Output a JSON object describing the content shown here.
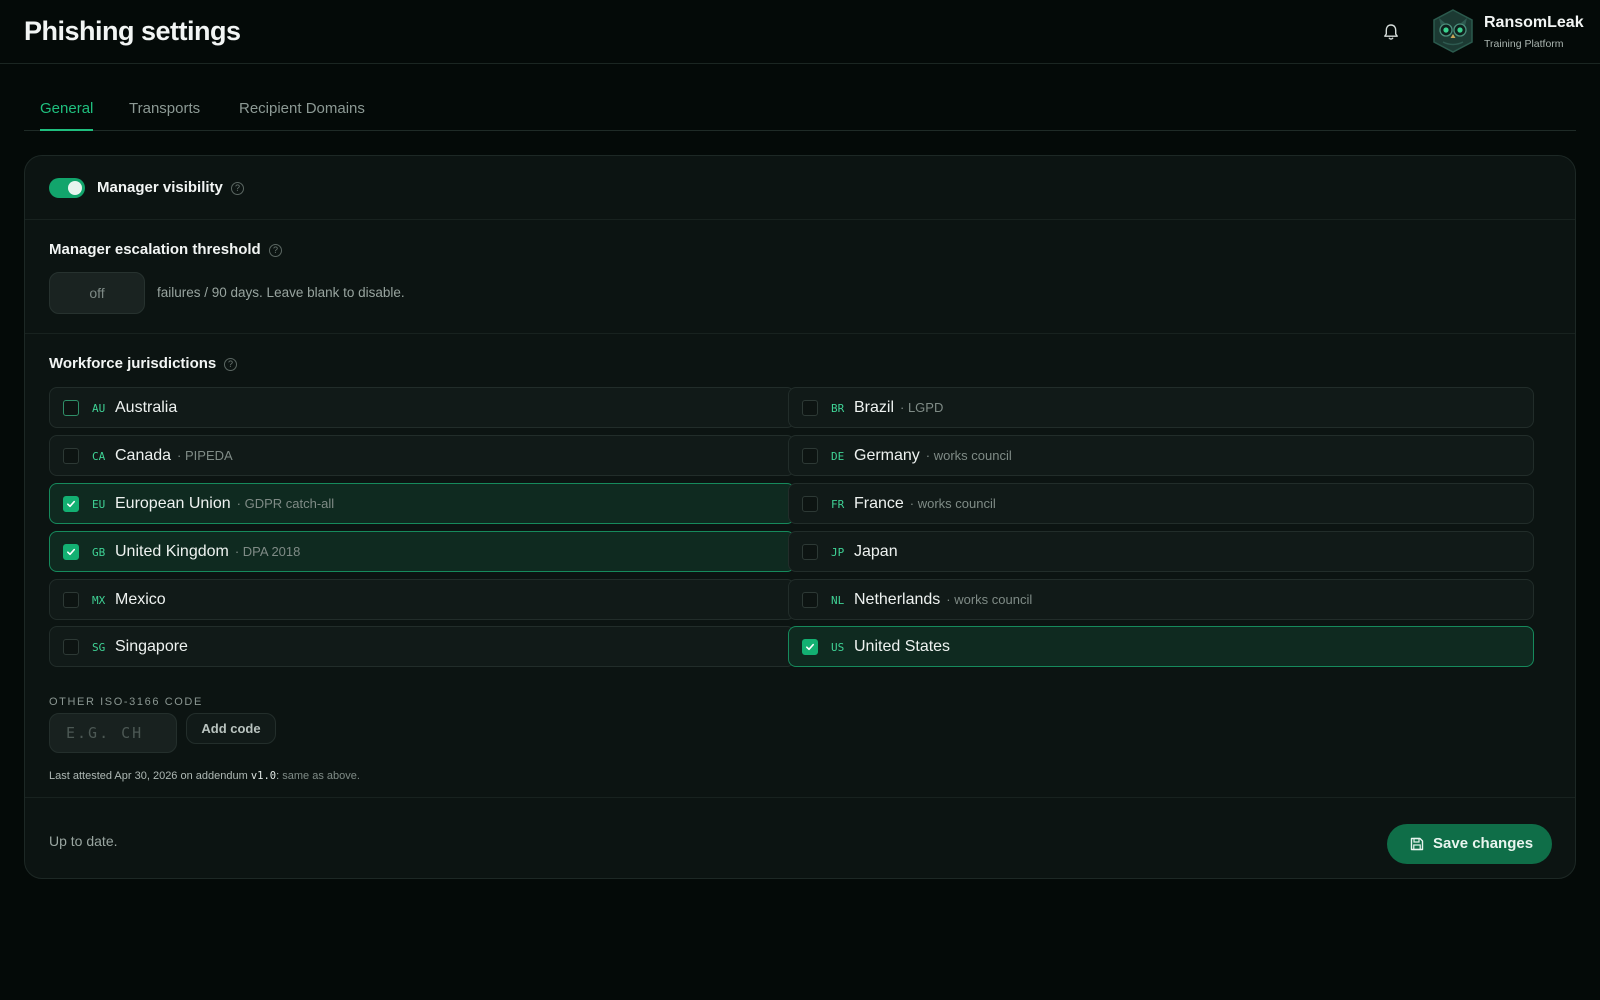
{
  "header": {
    "title": "Phishing settings",
    "brand_name": "RansomLeak",
    "brand_sub": "Training Platform"
  },
  "tabs": [
    {
      "label": "General",
      "active": true
    },
    {
      "label": "Transports",
      "active": false
    },
    {
      "label": "Recipient Domains",
      "active": false
    }
  ],
  "manager_visibility": {
    "label": "Manager visibility",
    "enabled": true
  },
  "threshold": {
    "label": "Manager escalation threshold",
    "value": "off",
    "hint": "failures / 90 days. Leave blank to disable."
  },
  "jurisdictions": {
    "label": "Workforce jurisdictions",
    "items": [
      {
        "code": "AU",
        "name": "Australia",
        "note": "",
        "checked": false
      },
      {
        "code": "BR",
        "name": "Brazil",
        "note": "· LGPD",
        "checked": false
      },
      {
        "code": "CA",
        "name": "Canada",
        "note": "· PIPEDA",
        "checked": false
      },
      {
        "code": "DE",
        "name": "Germany",
        "note": "· works council",
        "checked": false
      },
      {
        "code": "EU",
        "name": "European Union",
        "note": "· GDPR catch-all",
        "checked": true
      },
      {
        "code": "FR",
        "name": "France",
        "note": "· works council",
        "checked": false
      },
      {
        "code": "GB",
        "name": "United Kingdom",
        "note": "· DPA 2018",
        "checked": true
      },
      {
        "code": "JP",
        "name": "Japan",
        "note": "",
        "checked": false
      },
      {
        "code": "MX",
        "name": "Mexico",
        "note": "",
        "checked": false
      },
      {
        "code": "NL",
        "name": "Netherlands",
        "note": "· works council",
        "checked": false
      },
      {
        "code": "SG",
        "name": "Singapore",
        "note": "",
        "checked": false
      },
      {
        "code": "US",
        "name": "United States",
        "note": "",
        "checked": true
      }
    ]
  },
  "other_code": {
    "label": "OTHER ISO-3166 CODE",
    "placeholder": "E.G. CH",
    "button": "Add code"
  },
  "attestation": {
    "prefix": "Last attested Apr 30, 2026 on addendum",
    "version": "v1.0",
    "suffix": ":",
    "detail": "same as above."
  },
  "footer": {
    "status": "Up to date.",
    "save_label": "Save changes"
  },
  "colors": {
    "accent": "#1fbf7e",
    "background": "#040a08",
    "card": "#0c1412"
  },
  "icons": {
    "bell": "bell-icon",
    "avatar": "owl-avatar",
    "save": "save-icon",
    "help": "help-icon"
  }
}
